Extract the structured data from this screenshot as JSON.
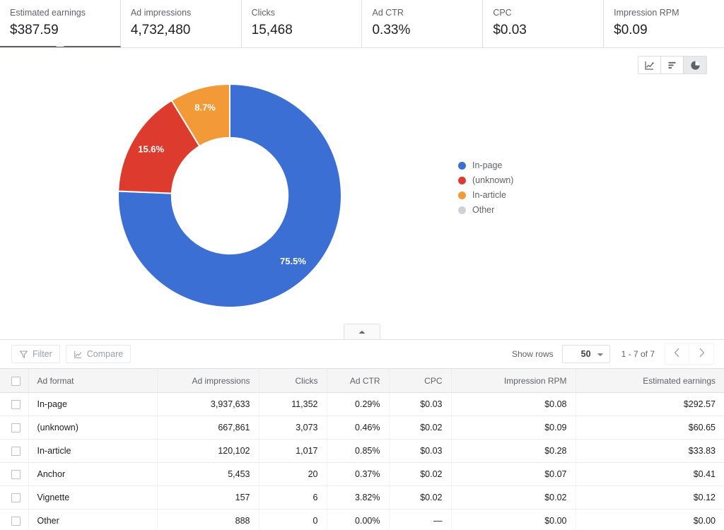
{
  "metrics": [
    {
      "label": "Estimated earnings",
      "value": "$387.59",
      "selected": true
    },
    {
      "label": "Ad impressions",
      "value": "4,732,480",
      "selected": false
    },
    {
      "label": "Clicks",
      "value": "15,468",
      "selected": false
    },
    {
      "label": "Ad CTR",
      "value": "0.33%",
      "selected": false
    },
    {
      "label": "CPC",
      "value": "$0.03",
      "selected": false
    },
    {
      "label": "Impression RPM",
      "value": "$0.09",
      "selected": false
    }
  ],
  "chart_toggle": [
    {
      "icon": "line-chart-icon",
      "active": false
    },
    {
      "icon": "bar-chart-icon",
      "active": false
    },
    {
      "icon": "pie-chart-icon",
      "active": true
    }
  ],
  "chart_data": {
    "type": "pie",
    "variant": "donut",
    "title": "",
    "categories": [
      "In-page",
      "(unknown)",
      "In-article",
      "Other"
    ],
    "values": [
      75.5,
      15.6,
      8.7,
      0.0
    ],
    "value_labels": [
      "75.5%",
      "15.6%",
      "8.7%",
      ""
    ],
    "colors": [
      "#3b6fd4",
      "#dc3b2e",
      "#f29a38",
      "#cfd2d4"
    ],
    "legend_position": "right",
    "start_angle_deg": 0,
    "direction": "clockwise",
    "inner_radius_ratio": 0.52
  },
  "legend": {
    "items": [
      {
        "label": "In-page",
        "color": "#3b6fd4"
      },
      {
        "label": "(unknown)",
        "color": "#dc3b2e"
      },
      {
        "label": "In-article",
        "color": "#f29a38"
      },
      {
        "label": "Other",
        "color": "#cfd2d4"
      }
    ]
  },
  "collapse": {
    "icon": "chevron-up-icon"
  },
  "table_toolbar": {
    "filter_label": "Filter",
    "compare_label": "Compare",
    "show_rows_label": "Show rows",
    "rows_value": "50",
    "page_range": "1 - 7 of 7",
    "prev_icon": "chevron-left-icon",
    "next_icon": "chevron-right-icon"
  },
  "table": {
    "columns": [
      "Ad format",
      "Ad impressions",
      "Clicks",
      "Ad CTR",
      "CPC",
      "Impression RPM",
      "Estimated earnings"
    ],
    "rows": [
      {
        "format": "In-page",
        "impressions": "3,937,633",
        "clicks": "11,352",
        "ctr": "0.29%",
        "cpc": "$0.03",
        "rpm": "$0.08",
        "earnings": "$292.57"
      },
      {
        "format": "(unknown)",
        "impressions": "667,861",
        "clicks": "3,073",
        "ctr": "0.46%",
        "cpc": "$0.02",
        "rpm": "$0.09",
        "earnings": "$60.65"
      },
      {
        "format": "In-article",
        "impressions": "120,102",
        "clicks": "1,017",
        "ctr": "0.85%",
        "cpc": "$0.03",
        "rpm": "$0.28",
        "earnings": "$33.83"
      },
      {
        "format": "Anchor",
        "impressions": "5,453",
        "clicks": "20",
        "ctr": "0.37%",
        "cpc": "$0.02",
        "rpm": "$0.07",
        "earnings": "$0.41"
      },
      {
        "format": "Vignette",
        "impressions": "157",
        "clicks": "6",
        "ctr": "3.82%",
        "cpc": "$0.02",
        "rpm": "$0.02",
        "earnings": "$0.12"
      },
      {
        "format": "Other",
        "impressions": "888",
        "clicks": "0",
        "ctr": "0.00%",
        "cpc": "—",
        "rpm": "$0.00",
        "earnings": "$0.00"
      }
    ]
  }
}
